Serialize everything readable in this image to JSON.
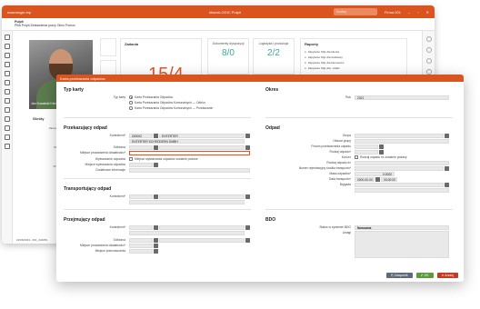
{
  "bg_app": {
    "title_left": "macrologic erp",
    "title_center": "MacroLOGIC Pulpit",
    "search_placeholder": "Szukaj",
    "title_right_firm": "Firma 001",
    "ribbon_tab": "Pulpit",
    "ribbon_menu": "PBA Pulpit Zestawienia pracy Okno Pomoc",
    "photo_caption": "Jan Kowalski Kierownik działu",
    "left_label": "Skróty",
    "left_items": [
      "Zlecenia serwisowe",
      "Technologie",
      "Przewoźnicy"
    ],
    "tile1_title": "Zadania",
    "tile1_value": "15/4",
    "tile2_title": "Dokumenty dyspozycji",
    "tile2_value": "8/0",
    "tile3_title": "Logistyka i produkcja",
    "tile3_value": "2/2",
    "raporty_title": "Raporty",
    "raporty": [
      "Zapytanie SQL dla klienta",
      "Zapytanie SQL dla dostawcy",
      "Zapytanie SQL dla kierowców",
      "Zapytanie SQL dla - kratki"
    ],
    "status": "22/06/2023 - 001_ADMIN"
  },
  "dialog": {
    "title": "Karta przekazania odpadów",
    "typ_karty": {
      "heading": "Typ karty",
      "label": "Typ karty",
      "options": [
        {
          "text": "Karta Przekazania Odpadów",
          "selected": true
        },
        {
          "text": "Karta Przekazania Odpadów Komunalnych — Odbiór",
          "selected": false
        },
        {
          "text": "Karta Przekazania Odpadów Komunalnych — Przekazanie",
          "selected": false
        }
      ]
    },
    "okres": {
      "heading": "Okres",
      "rok_label": "Rok",
      "rok_value": "2021"
    },
    "przekazujacy": {
      "heading": "Przekazujący odpad",
      "kontrahent_label": "Kontrahent*",
      "kontrahent_code": "000002",
      "kontrahent_name": "ENTERTER",
      "kontrahent_full": "ENTERTER SCHRÖDERN GMBH",
      "odbiorca_label": "Odbiorca",
      "miejsce_label": "Miejsce prowadzenia działalności*",
      "wytwarzanie_label": "Wytwarzanie odpadów",
      "wytwarzanie_text": "Miejsce wytwarzania odpadów zostanie podane",
      "miejsce_wytw_label": "Miejsce wytwarzania odpadów",
      "dodatkowe_label": "Dodatkowe informacje"
    },
    "transportujacy": {
      "heading": "Transportujący odpad",
      "kontrahent_label": "Kontrahent*"
    },
    "przejmujacy": {
      "heading": "Przejmujący odpad",
      "kontrahent_label": "Kontrahent*",
      "odbiorca_label": "Odbiorca",
      "miejsce_label": "Miejsce prowadzenia działalności*",
      "miejsce_przetw_label": "Miejsce przeznaczenia"
    },
    "odpad": {
      "heading": "Odpad",
      "grupa_label": "Grupa",
      "obszar_label": "Obszar grupy",
      "proces_label": "Proces przetwarzania odpadu",
      "rodzaj_label": "Rodzaj odpadu*",
      "kod_label": "Kod.ex",
      "kod_text": "Rodzaj odpadu ex zostanie podany",
      "rodzaj2_label": "Rodzaj odpadu ex",
      "numer_label": "Numer rejestracyjny środka transportu*",
      "masa_label": "Masa odpadów*",
      "masa_value": "0,0000",
      "data_label": "Data transportu*",
      "data_date": "0000-00-00",
      "data_time": "00:00:00",
      "brygada_label": "Brygada"
    },
    "bdo": {
      "heading": "BDO",
      "status_label": "Status w systemie BDO",
      "status_value": "Nowowna",
      "uwagi_label": "Uwagi"
    },
    "buttons": {
      "zalacznik": "Załącznik",
      "ok": "OK",
      "anuluj": "Anuluj"
    }
  },
  "colors": {
    "accent": "#d9541e",
    "green": "#5b9b3c",
    "red": "#c53a22",
    "teal": "#3fa6a0"
  }
}
